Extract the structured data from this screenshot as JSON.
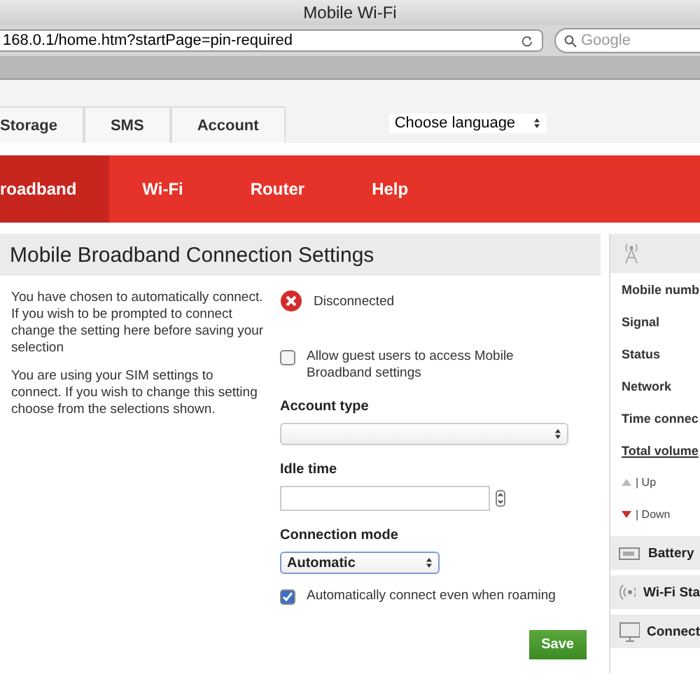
{
  "window": {
    "title": "Mobile Wi-Fi"
  },
  "browser": {
    "url": "168.0.1/home.htm?startPage=pin-required",
    "search": {
      "placeholder": "Google"
    }
  },
  "top_tabs": [
    {
      "label": "Storage"
    },
    {
      "label": "SMS"
    },
    {
      "label": "Account"
    }
  ],
  "language": {
    "value": "Choose language"
  },
  "nav": [
    {
      "label": "roadband",
      "selected": true
    },
    {
      "label": "Wi-Fi",
      "selected": false
    },
    {
      "label": "Router",
      "selected": false
    },
    {
      "label": "Help",
      "selected": false
    }
  ],
  "panel": {
    "title": "Mobile Broadband Connection Settings",
    "notes": [
      "You have chosen to automatically connect. If you wish to be prompted to connect change the setting here before saving your selection",
      "You are using your SIM settings to connect. If you wish to change this setting choose from the selections shown."
    ],
    "status": "Disconnected",
    "guest": {
      "label": "Allow guest users to access Mobile Broadband settings",
      "checked": false
    },
    "account_type": {
      "label": "Account type"
    },
    "idle_time": {
      "label": "Idle time"
    },
    "connection_mode": {
      "label": "Connection mode",
      "value": "Automatic"
    },
    "roaming": {
      "label": "Automatically connect even when roaming",
      "checked": true
    },
    "save": "Save"
  },
  "sidebar": {
    "rows": [
      "Mobile numb",
      "Signal",
      "Status",
      "Network",
      "Time connec"
    ],
    "total": "Total volume",
    "up": "| Up",
    "down": "| Down",
    "sections": [
      {
        "kind": "battery",
        "label": "Battery"
      },
      {
        "kind": "wifi",
        "label": "Wi-Fi Sta"
      },
      {
        "kind": "monitor",
        "label": "Connect"
      }
    ]
  }
}
